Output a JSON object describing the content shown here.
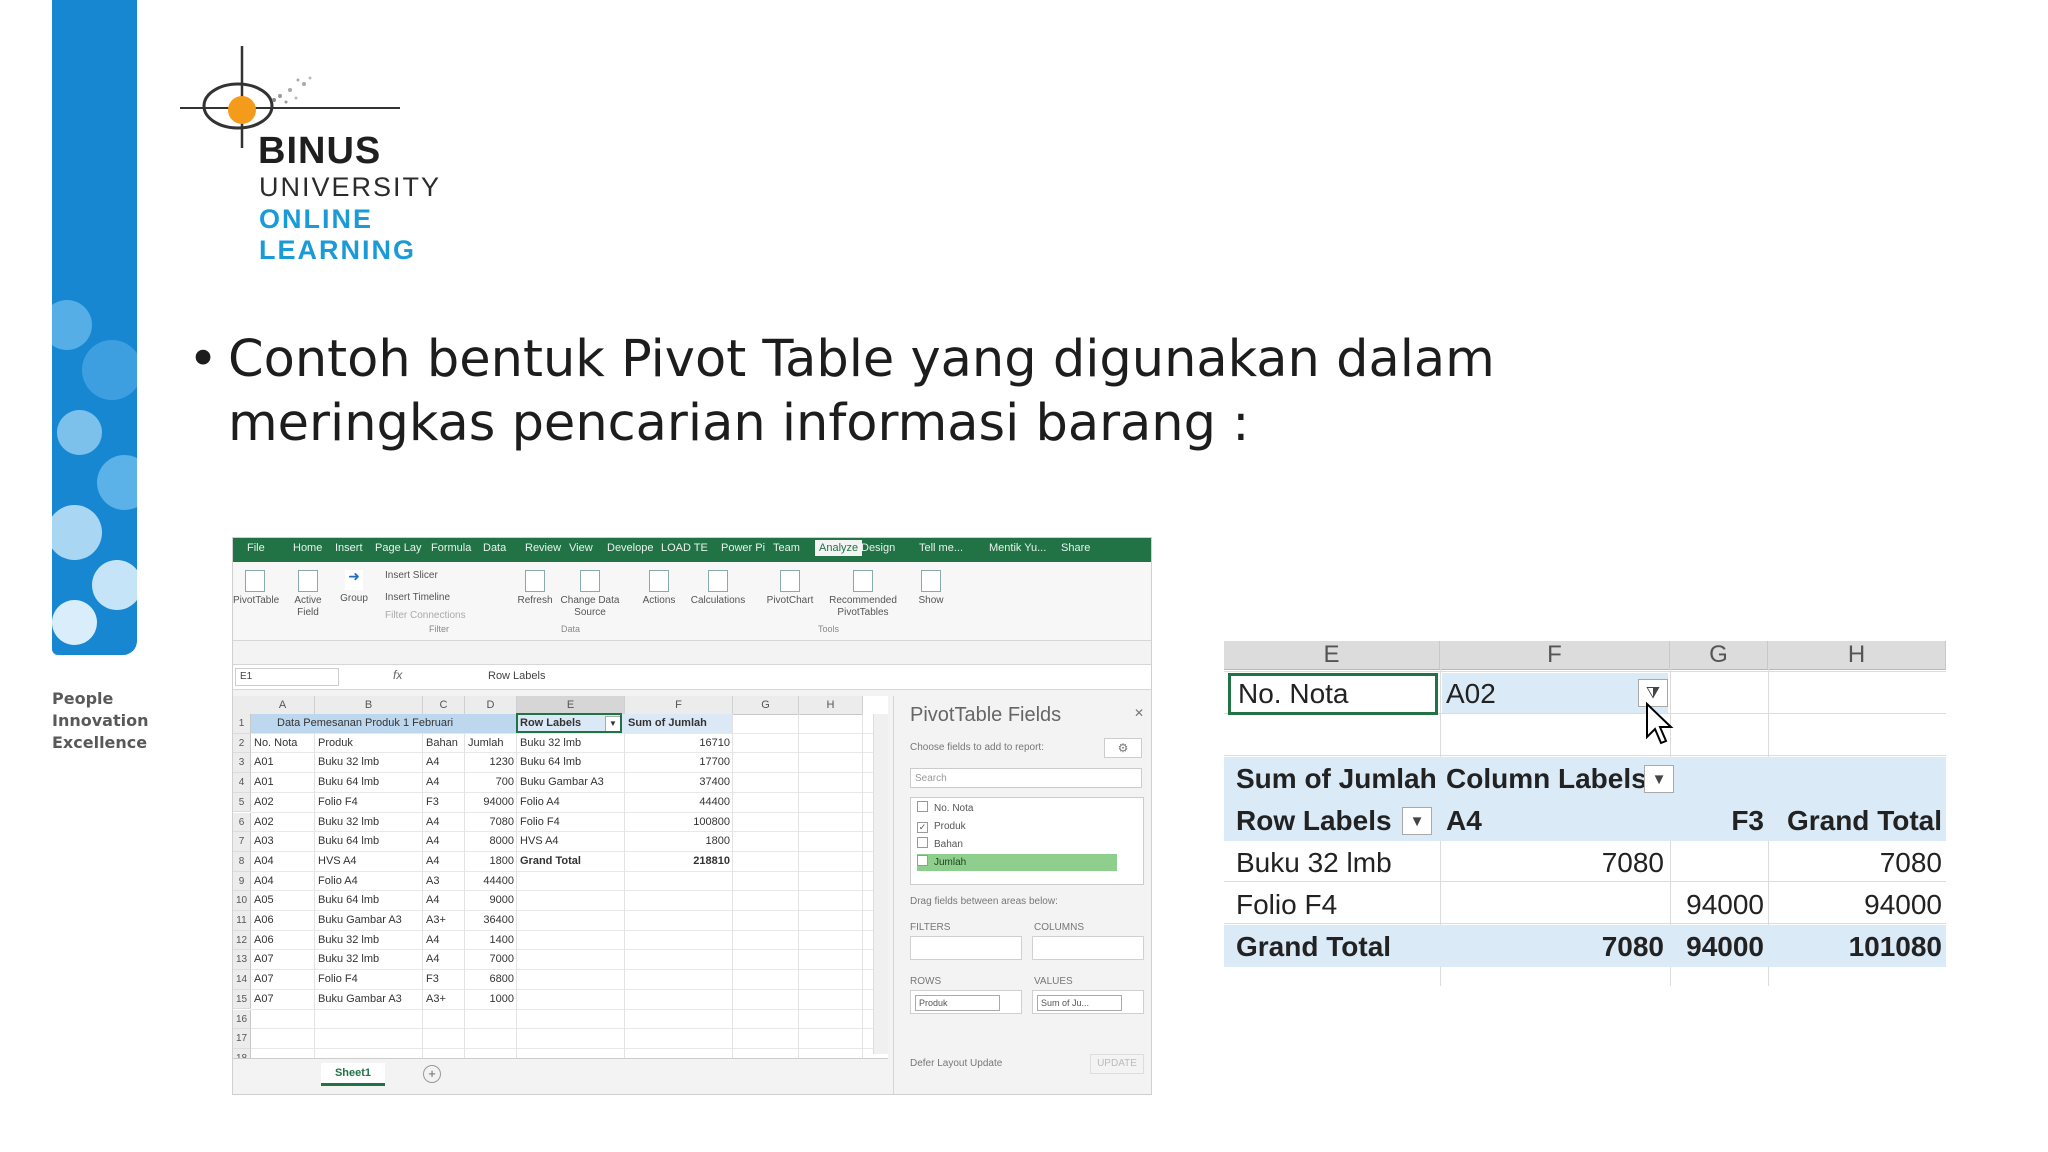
{
  "brand": {
    "binus": "BINUS",
    "university": "UNIVERSITY",
    "online": "ONLINE",
    "learning": "LEARNING",
    "tagline": [
      "People",
      "Innovation",
      "Excellence"
    ],
    "colors": {
      "bar": "#1787d2",
      "accent": "#1a9bd7",
      "orange": "#f59b1c"
    }
  },
  "slide": {
    "bullet_symbol": "•",
    "bullet_text": "Contoh bentuk Pivot Table yang digunakan dalam meringkas pencarian informasi barang :"
  },
  "excel": {
    "tabs": [
      "File",
      "Home",
      "Insert",
      "Page Lay",
      "Formula",
      "Data",
      "Review",
      "View",
      "Develope",
      "LOAD TE",
      "Power Pi",
      "Team",
      "Analyze",
      "Design",
      "Tell me...",
      "Mentik Yu...",
      "Share"
    ],
    "active_tab": "Analyze",
    "ribbon": {
      "pivottable": "PivotTable",
      "active_field": "Active Field",
      "group": "Group",
      "insert_slicer": "Insert Slicer",
      "insert_timeline": "Insert Timeline",
      "filter_connections": "Filter Connections",
      "refresh": "Refresh",
      "change_data_source": "Change Data Source",
      "actions": "Actions",
      "calculations": "Calculations",
      "pivotchart": "PivotChart",
      "recommended": "Recommended PivotTables",
      "show": "Show",
      "group_filter": "Filter",
      "group_data": "Data",
      "group_tools": "Tools"
    },
    "name_box": "E1",
    "fx": "fx",
    "formula_value": "Row Labels",
    "columns": [
      "A",
      "B",
      "C",
      "D",
      "E",
      "F",
      "G",
      "H"
    ],
    "rows": [
      "1",
      "2",
      "3",
      "4",
      "5",
      "6",
      "7",
      "8",
      "9",
      "10",
      "11",
      "12",
      "13",
      "14",
      "15",
      "16",
      "17",
      "18"
    ],
    "data_title": "Data Pemesanan Produk 1 Februari",
    "headers": [
      "No. Nota",
      "Produk",
      "Bahan",
      "Jumlah"
    ],
    "data": [
      [
        "A01",
        "Buku 32 lmb",
        "A4",
        "1230"
      ],
      [
        "A01",
        "Buku 64 lmb",
        "A4",
        "700"
      ],
      [
        "A02",
        "Folio F4",
        "F3",
        "94000"
      ],
      [
        "A02",
        "Buku 32 lmb",
        "A4",
        "7080"
      ],
      [
        "A03",
        "Buku 64 lmb",
        "A4",
        "8000"
      ],
      [
        "A04",
        "HVS A4",
        "A4",
        "1800"
      ],
      [
        "A04",
        "Folio A4",
        "A3",
        "44400"
      ],
      [
        "A05",
        "Buku 64 lmb",
        "A4",
        "9000"
      ],
      [
        "A06",
        "Buku Gambar A3",
        "A3+",
        "36400"
      ],
      [
        "A06",
        "Buku 32 lmb",
        "A4",
        "1400"
      ],
      [
        "A07",
        "Buku 32 lmb",
        "A4",
        "7000"
      ],
      [
        "A07",
        "Folio F4",
        "F3",
        "6800"
      ],
      [
        "A07",
        "Buku Gambar A3",
        "A3+",
        "1000"
      ]
    ],
    "pivot_header": [
      "Row Labels",
      "Sum of Jumlah"
    ],
    "pivot_rows": [
      [
        "Buku 32 lmb",
        "16710"
      ],
      [
        "Buku 64 lmb",
        "17700"
      ],
      [
        "Buku Gambar A3",
        "37400"
      ],
      [
        "Folio A4",
        "44400"
      ],
      [
        "Folio F4",
        "100800"
      ],
      [
        "HVS A4",
        "1800"
      ],
      [
        "Grand Total",
        "218810"
      ]
    ],
    "sheet_tab": "Sheet1",
    "panel": {
      "title": "PivotTable Fields",
      "choose": "Choose fields to add to report:",
      "search": "Search",
      "fields": [
        "No. Nota",
        "Produk",
        "Bahan",
        "Jumlah"
      ],
      "drag": "Drag fields between areas below:",
      "filters": "FILTERS",
      "columns": "COLUMNS",
      "rows": "ROWS",
      "values": "VALUES",
      "rows_value": "Produk",
      "values_value": "Sum of Ju...",
      "defer": "Defer Layout Update",
      "update": "UPDATE"
    }
  },
  "zoom": {
    "cols": [
      "E",
      "F",
      "G",
      "H"
    ],
    "filter_label": "No. Nota",
    "filter_value": "A02",
    "sum_label": "Sum of Jumlah",
    "col_labels": "Column Labels",
    "row_labels": "Row Labels",
    "col_a4": "A4",
    "col_f3": "F3",
    "grand_total_col": "Grand Total",
    "rows": [
      {
        "label": "Buku 32 lmb",
        "a4": "7080",
        "f3": "",
        "total": "7080"
      },
      {
        "label": "Folio F4",
        "a4": "",
        "f3": "94000",
        "total": "94000"
      },
      {
        "label": "Grand Total",
        "a4": "7080",
        "f3": "94000",
        "total": "101080"
      }
    ]
  }
}
